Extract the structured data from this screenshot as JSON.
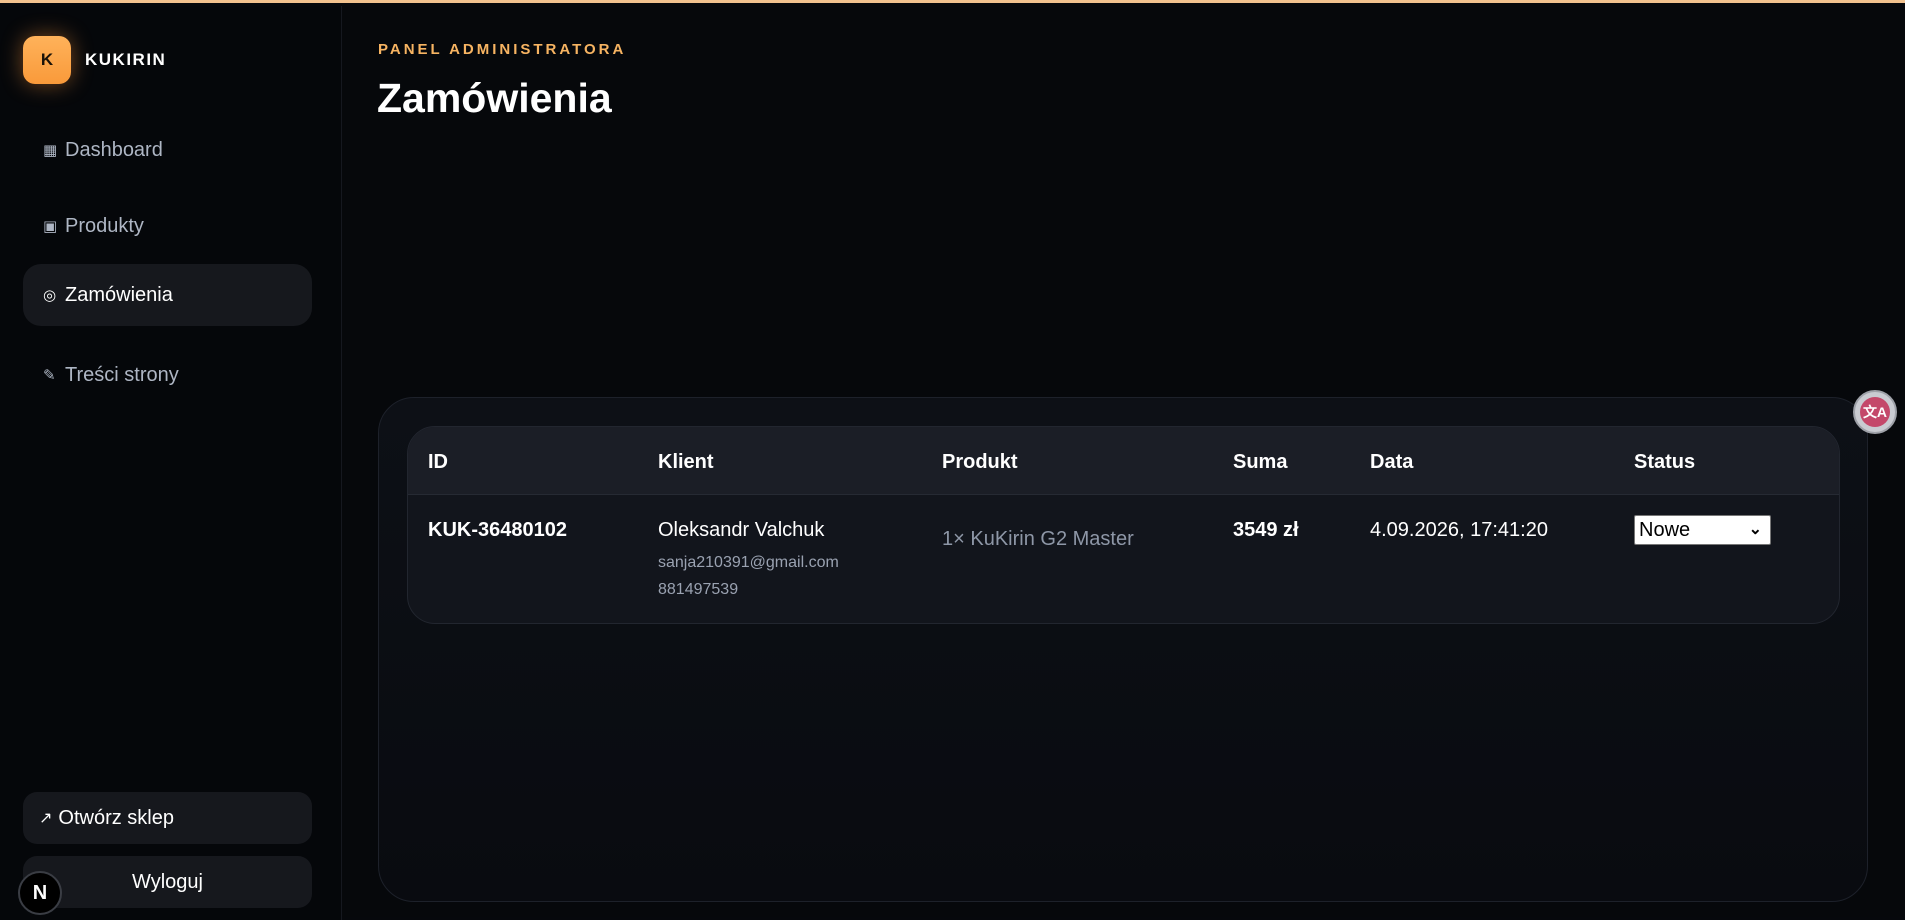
{
  "brand": {
    "logo_letter": "K",
    "name": "KUKIRIN"
  },
  "sidebar": {
    "items": [
      {
        "icon": "▦",
        "icon_name": "grid-icon",
        "label": "Dashboard",
        "active": false
      },
      {
        "icon": "▣",
        "icon_name": "box-icon",
        "label": "Produkty",
        "active": false
      },
      {
        "icon": "◎",
        "icon_name": "target-icon",
        "label": "Zamówienia",
        "active": true
      },
      {
        "icon": "✎",
        "icon_name": "pencil-icon",
        "label": "Treści strony",
        "active": false
      }
    ],
    "open_store": {
      "icon": "↗",
      "label": "Otwórz sklep"
    },
    "logout_label": "Wyloguj",
    "next_badge": "N"
  },
  "header": {
    "eyebrow": "PANEL ADMINISTRATORA",
    "title": "Zamówienia"
  },
  "table": {
    "columns": [
      "ID",
      "Klient",
      "Produkt",
      "Suma",
      "Data",
      "Status"
    ],
    "rows": [
      {
        "id": "KUK-36480102",
        "client_name": "Oleksandr Valchuk",
        "client_email": "sanja210391@gmail.com",
        "client_phone": "881497539",
        "product": "1× KuKirin G2 Master",
        "sum": "3549 zł",
        "date": "4.09.2026, 17:41:20",
        "status": "Nowe"
      }
    ]
  },
  "colors": {
    "accent": "#f7b462",
    "background": "#06080b",
    "panel": "#12151c"
  }
}
